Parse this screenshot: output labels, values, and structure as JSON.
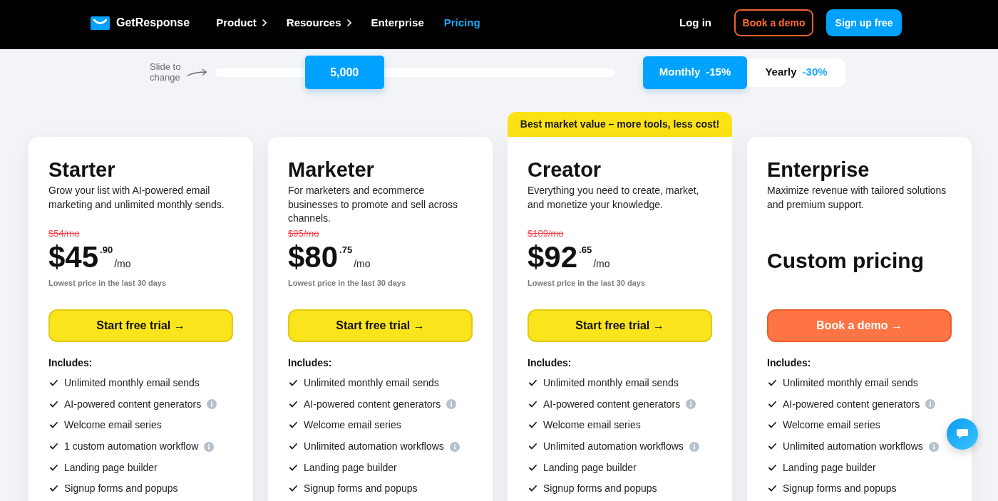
{
  "header": {
    "logo": "GetResponse",
    "nav": [
      {
        "label": "Product",
        "dropdown": true,
        "selected": false
      },
      {
        "label": "Resources",
        "dropdown": true,
        "selected": false
      },
      {
        "label": "Enterprise",
        "dropdown": false,
        "selected": false
      },
      {
        "label": "Pricing",
        "dropdown": false,
        "selected": true
      }
    ],
    "actions": [
      {
        "kind": "link",
        "label": "Log in"
      },
      {
        "kind": "outline",
        "label": "Book a demo"
      },
      {
        "kind": "primary",
        "label": "Sign up free"
      }
    ]
  },
  "contacts_slider": {
    "hint": "Slide to change",
    "value": "5,000",
    "level": 0.28
  },
  "billing": [
    {
      "label": "Monthly",
      "discount": "-15%",
      "selected": true
    },
    {
      "label": "Yearly",
      "discount": "-30%",
      "selected": false
    }
  ],
  "plans": [
    {
      "kind": "priced",
      "name": "Starter",
      "description": "Grow your list with AI-powered email marketing and unlimited monthly sends.",
      "old_price": "$54/mo",
      "price": "$45",
      "cents": ".90",
      "period": "/mo",
      "note": "Lowest price in the last 30 days",
      "button": {
        "kind": "trial",
        "label": "Start free trial →"
      },
      "includes_label": "Includes:",
      "features": [
        {
          "text": "Unlimited monthly email sends",
          "info": false
        },
        {
          "text": "AI-powered content generators",
          "info": true
        },
        {
          "text": "Welcome email series",
          "info": false
        },
        {
          "text": "1 custom automation workflow",
          "info": true
        },
        {
          "text": "Landing page builder",
          "info": false
        },
        {
          "text": "Signup forms and popups",
          "info": false
        }
      ]
    },
    {
      "kind": "priced",
      "name": "Marketer",
      "description": "For marketers and ecommerce businesses to promote and sell across channels.",
      "old_price": "$95/mo",
      "price": "$80",
      "cents": ".75",
      "period": "/mo",
      "note": "Lowest price in the last 30 days",
      "button": {
        "kind": "trial",
        "label": "Start free trial →"
      },
      "includes_label": "Includes:",
      "features": [
        {
          "text": "Unlimited monthly email sends",
          "info": false
        },
        {
          "text": "AI-powered content generators",
          "info": true
        },
        {
          "text": "Welcome email series",
          "info": false
        },
        {
          "text": "Unlimited automation workflows",
          "info": true
        },
        {
          "text": "Landing page builder",
          "info": false
        },
        {
          "text": "Signup forms and popups",
          "info": false
        }
      ]
    },
    {
      "kind": "priced",
      "badge": "Best market value – more tools, less cost!",
      "name": "Creator",
      "description": "Everything you need to create, market, and monetize your knowledge.",
      "old_price": "$109/mo",
      "price": "$92",
      "cents": ".65",
      "period": "/mo",
      "note": "Lowest price in the last 30 days",
      "button": {
        "kind": "trial",
        "label": "Start free trial →"
      },
      "includes_label": "Includes:",
      "features": [
        {
          "text": "Unlimited monthly email sends",
          "info": false
        },
        {
          "text": "AI-powered content generators",
          "info": true
        },
        {
          "text": "Welcome email series",
          "info": false
        },
        {
          "text": "Unlimited automation workflows",
          "info": true
        },
        {
          "text": "Landing page builder",
          "info": false
        },
        {
          "text": "Signup forms and popups",
          "info": false
        }
      ]
    },
    {
      "kind": "custom",
      "name": "Enterprise",
      "description": "Maximize revenue with tailored solutions and premium support.",
      "price": "Custom pricing",
      "button": {
        "kind": "demo",
        "label": "Book a demo →"
      },
      "includes_label": "Includes:",
      "features": [
        {
          "text": "Unlimited monthly email sends",
          "info": false
        },
        {
          "text": "AI-powered content generators",
          "info": true
        },
        {
          "text": "Welcome email series",
          "info": false
        },
        {
          "text": "Unlimited automation workflows",
          "info": true
        },
        {
          "text": "Landing page builder",
          "info": false
        },
        {
          "text": "Signup forms and popups",
          "info": false
        }
      ]
    }
  ]
}
